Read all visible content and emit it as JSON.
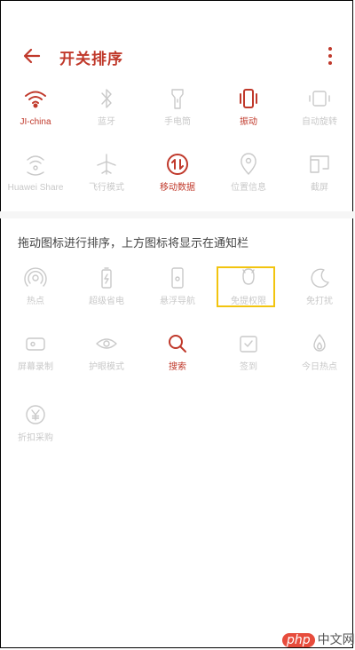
{
  "header": {
    "title": "开关排序"
  },
  "colors": {
    "accent": "#c0392b",
    "inactive": "#c9c9c9",
    "drag_highlight": "#f2c40f"
  },
  "top_grid": [
    {
      "label": "JI-china",
      "icon": "wifi-icon",
      "state": "active"
    },
    {
      "label": "蓝牙",
      "icon": "bluetooth-icon",
      "state": "inactive"
    },
    {
      "label": "手电筒",
      "icon": "flashlight-icon",
      "state": "inactive"
    },
    {
      "label": "振动",
      "icon": "vibrate-icon",
      "state": "active"
    },
    {
      "label": "自动旋转",
      "icon": "rotate-icon",
      "state": "inactive"
    },
    {
      "label": "Huawei Share",
      "icon": "share-icon",
      "state": "inactive"
    },
    {
      "label": "飞行模式",
      "icon": "airplane-icon",
      "state": "inactive"
    },
    {
      "label": "移动数据",
      "icon": "mobile-data-icon",
      "state": "active"
    },
    {
      "label": "位置信息",
      "icon": "location-icon",
      "state": "inactive"
    },
    {
      "label": "截屏",
      "icon": "screenshot-icon",
      "state": "inactive"
    }
  ],
  "hint": "拖动图标进行排序，上方图标将显示在通知栏",
  "bottom_grid": [
    {
      "label": "热点",
      "icon": "hotspot-icon",
      "state": "inactive"
    },
    {
      "label": "超级省电",
      "icon": "battery-icon",
      "state": "inactive"
    },
    {
      "label": "悬浮导航",
      "icon": "navigation-icon",
      "state": "inactive"
    },
    {
      "label": "免提权限",
      "icon": "handsfree-icon",
      "state": "inactive"
    },
    {
      "label": "免打扰",
      "icon": "moon-icon",
      "state": "inactive"
    },
    {
      "label": "屏幕录制",
      "icon": "record-icon",
      "state": "inactive"
    },
    {
      "label": "护眼模式",
      "icon": "eye-icon",
      "state": "inactive"
    },
    {
      "label": "搜索",
      "icon": "search-icon",
      "state": "active"
    },
    {
      "label": "签到",
      "icon": "checkin-icon",
      "state": "inactive"
    },
    {
      "label": "今日热点",
      "icon": "hot-icon",
      "state": "inactive"
    },
    {
      "label": "折扣采购",
      "icon": "yuan-icon",
      "state": "inactive"
    }
  ],
  "watermark": {
    "badge": "php",
    "text": "中文网"
  }
}
